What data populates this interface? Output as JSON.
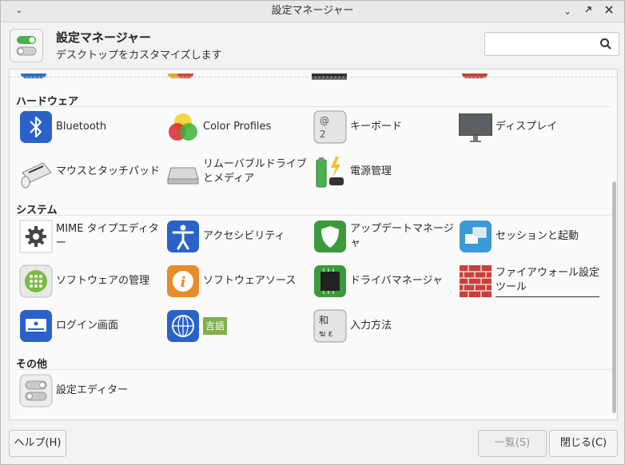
{
  "window": {
    "title": "設定マネージャー"
  },
  "header": {
    "title": "設定マネージャー",
    "subtitle": "デスクトップをカスタマイズします"
  },
  "search": {
    "placeholder": ""
  },
  "sections": [
    {
      "title": "ハードウェア",
      "items": [
        {
          "label": "Bluetooth",
          "icon": "bluetooth-icon"
        },
        {
          "label": "Color Profiles",
          "icon": "color-profiles-icon"
        },
        {
          "label": "キーボード",
          "icon": "keyboard-icon"
        },
        {
          "label": "ディスプレイ",
          "icon": "display-icon"
        },
        {
          "label": "マウスとタッチパッド",
          "icon": "mouse-touchpad-icon"
        },
        {
          "label": "リムーバブルドライブとメディア",
          "icon": "removable-drive-icon"
        },
        {
          "label": "電源管理",
          "icon": "power-manager-icon"
        }
      ]
    },
    {
      "title": "システム",
      "items": [
        {
          "label": "MIME タイプエディター",
          "icon": "mime-editor-icon"
        },
        {
          "label": "アクセシビリティ",
          "icon": "accessibility-icon"
        },
        {
          "label": "アップデートマネージャ",
          "icon": "update-manager-icon"
        },
        {
          "label": "セッションと起動",
          "icon": "session-startup-icon"
        },
        {
          "label": "ソフトウェアの管理",
          "icon": "software-manager-icon"
        },
        {
          "label": "ソフトウェアソース",
          "icon": "software-sources-icon"
        },
        {
          "label": "ドライバマネージャ",
          "icon": "driver-manager-icon"
        },
        {
          "label": "ファイアウォール設定ツール",
          "icon": "firewall-icon"
        },
        {
          "label": "ログイン画面",
          "icon": "login-screen-icon"
        },
        {
          "label": "言語",
          "icon": "language-icon"
        },
        {
          "label": "入力方法",
          "icon": "input-method-icon"
        }
      ]
    },
    {
      "title": "その他",
      "items": [
        {
          "label": "設定エディター",
          "icon": "settings-editor-icon"
        }
      ]
    }
  ],
  "footer": {
    "help": "ヘルプ(H)",
    "overview": "一覧(S)",
    "close": "閉じる(C)"
  },
  "icon_glyphs": {
    "keyboard_top": "@",
    "keyboard_bottom": "2",
    "language_badge": "言語",
    "input_method_top": "和",
    "input_method_bottom": "ฆ ε"
  },
  "colors": {
    "accent_green": "#4caf50",
    "window_bg": "#f2f2f2",
    "content_bg": "#fafafa"
  }
}
